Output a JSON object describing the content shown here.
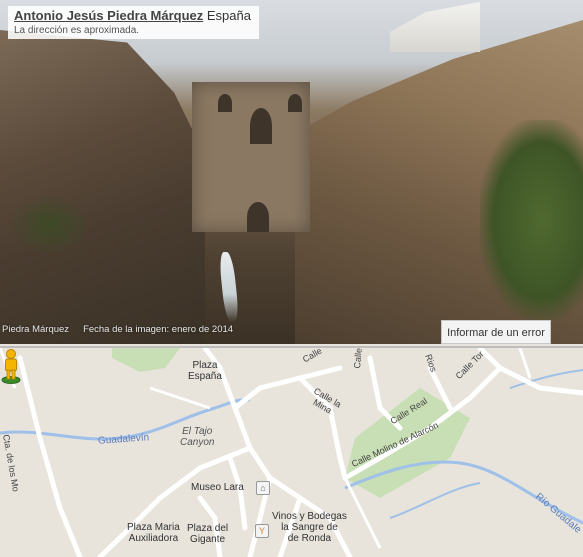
{
  "street_view": {
    "author": "Antonio Jesús Piedra Márquez",
    "country": "España",
    "address_note": "La dirección es aproximada.",
    "photo_credit": "Piedra Márquez",
    "image_date": "Fecha de la imagen: enero de 2014",
    "report_button": "Informar de un error"
  },
  "map": {
    "labels": {
      "plaza_espana": [
        "Plaza",
        "España"
      ],
      "calle_top_1": "Calle",
      "calle_top_2": "Calle San",
      "calle_top_3": "Rios",
      "calle_top_4": "Calle Tor",
      "calle_la_mina": [
        "Calle la",
        "Mina"
      ],
      "calle_real": "Calle Real",
      "calle_alarcon": "Calle Molino de Alarcón",
      "cta_de_los_molinos": "Cta. de los Mo",
      "guadalevin": "Guadalevín",
      "el_tajo": [
        "El Tajo",
        "Canyon"
      ],
      "museo_lara": "Museo Lara",
      "vinos": [
        "Vinos y Bodegas",
        "la Sangre de",
        "de Ronda"
      ],
      "plaza_maria": [
        "Plaza Maria",
        "Auxiliadora"
      ],
      "plaza_gigante": [
        "Plaza del",
        "Gigante"
      ],
      "rio_guadalevin": "Río Guadale"
    },
    "icons": {
      "museum": "museum-icon",
      "wine": "wine-glass-icon",
      "pegman": "pegman-icon"
    },
    "colors": {
      "background": "#e8e4dc",
      "road": "#ffffff",
      "river": "#9fc0e8",
      "park": "#c8dfb5"
    }
  }
}
